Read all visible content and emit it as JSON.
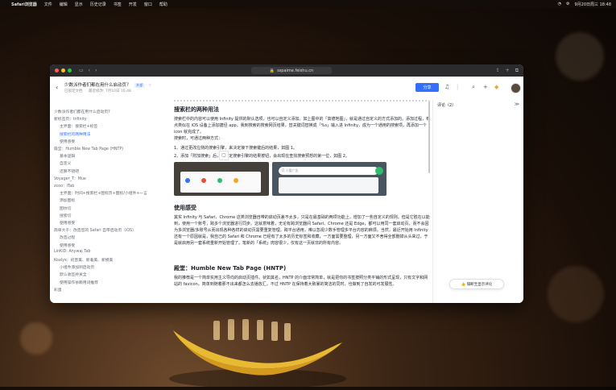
{
  "menubar": {
    "apple": "",
    "items": [
      "Safari浏览器",
      "文件",
      "编辑",
      "显示",
      "历史记录",
      "书签",
      "开发",
      "窗口",
      "帮助"
    ],
    "right_time": "9月20日周三 18:48"
  },
  "browser": {
    "url": "sspaime.feishu.cn"
  },
  "doc": {
    "title": "少数派作者们都在用什么启动页？",
    "badge": "外部",
    "meta_author": "已锁定文档",
    "meta_modified": "最近修改: 7月10日 16:48",
    "share_label": "分享"
  },
  "toc": [
    {
      "label": "少数派作者们都在用什么启动页?",
      "level": 0,
      "active": false
    },
    {
      "label": "新标签页：Infinity",
      "level": 1,
      "active": false
    },
    {
      "label": "主界面：搜索栏+标签",
      "level": 2,
      "active": false
    },
    {
      "label": "搜索栏的两种用法",
      "level": 2,
      "active": true
    },
    {
      "label": "使用感受",
      "level": 2,
      "active": false
    },
    {
      "label": "殿堂：Humble New Tab Page (HNTP)",
      "level": 1,
      "active": false
    },
    {
      "label": "基本逻辑",
      "level": 2,
      "active": false
    },
    {
      "label": "自定义",
      "level": 2,
      "active": false
    },
    {
      "label": "还算不错吧",
      "level": 2,
      "active": false
    },
    {
      "label": "Voyager_T：Mue",
      "level": 1,
      "active": false
    },
    {
      "label": "zcoo：iTab",
      "level": 1,
      "active": false
    },
    {
      "label": "主界面：时间+搜索栏+图标页+图标/小组件+一言",
      "level": 2,
      "active": false
    },
    {
      "label": "添加图标",
      "level": 2,
      "active": false
    },
    {
      "label": "图纹切",
      "level": 2,
      "active": false
    },
    {
      "label": "搜索切",
      "level": 2,
      "active": false
    },
    {
      "label": "使用感受",
      "level": 2,
      "active": false
    },
    {
      "label": "简单大于：改造您的 Safari 自带启动页（iOS）",
      "level": 1,
      "active": false
    },
    {
      "label": "改造过程",
      "level": 2,
      "active": false
    },
    {
      "label": "使用感受",
      "level": 2,
      "active": false
    },
    {
      "label": "LinKiD: Anywaj Tab",
      "level": 1,
      "active": false
    },
    {
      "label": "Koalyx：初音美、新着美、新摸美",
      "level": 1,
      "active": false
    },
    {
      "label": "小组件添加到启动页",
      "level": 2,
      "active": false
    },
    {
      "label": "默认收签并关全",
      "level": 2,
      "active": false
    },
    {
      "label": "使用操作依赖用词推荐",
      "level": 2,
      "active": false
    },
    {
      "label": "彩蛋",
      "level": 1,
      "active": false
    }
  ],
  "content": {
    "h_search": "搜索栏的两种用法",
    "p1": "搜索栏中的内容可以使用 Infinity 提供的默认选项，也可以自定义添加。如上图中的「高德地图」，就是通过自定义的方式添加的。添加过程，有点类似在 iOS 设备上添加捷径 app，我到搜索的搜索网页结果，替关键词替换成「%s」输入进 Infinity，成为一个通用的搜索项。再添加一个 icon 就完成了。",
    "p2": "搜索时，可通过两种方式：",
    "li1": "1、通过更改左侧的搜索引擎，来决定接下搜索键后的结果，如图 1。",
    "li2": "2、添加「附加搜索」后，再决定搜索引擎的结果按钮，会出现在查找搜索预想的第一位，如图 2。",
    "search_placeholder": "Q 人搜广告",
    "h_feel": "使用感受",
    "p3": "其实 Infinity 与 Safari、Chrome 这类浏览器自带的启动页差不太多，只是在最基础的两项功能上，增加了一些自定义的规则。但是它胜在以能到，使用一个账号，跨多个浏览器进行同步。这就意味着，无论有跨浏览器间 Safari、Chrome 还是 Edge，都可以用同一套启动页，而不会因为多浏览器/多账号从而出现各种各样的启动页需要重复管理。跨平台通用，难以忽视少数手管理多平台内容的麻烦。当然，最近开始用 Infinity 还有一个原因就是，我自己的 Safari 和 Chrome 已经有了太多的历史标签和收藏，一方面需要整理，另一方面又不舍得全部删掉从头来过，于是就启用另一套系统重新开始管理了。笔新的「系统」肉容很少，仅有这一页就非的所有内容。",
    "h_hntp": "殿堂：Humble New Tab Page (HNTP)",
    "p4": "我的推荐是一个简单实用主义导向的启动页插件。状如其名，HNTP 的介面非常简单，就是把你的书签按照分类平铺的形式呈现，只有文字和网站的 favicon。简单到随着那不出来都怎么去播放汇。不过 HNTP 在保持着大致暴的简洁的同时，也做到了自发的可发展性。"
  },
  "comments": {
    "title": "评论（2）",
    "collapse": "≫",
    "pill": "👍 隔断至显示评论"
  },
  "icons": {
    "back": "‹",
    "bell": "bell-icon",
    "search": "search-icon",
    "plus": "plus-icon"
  }
}
